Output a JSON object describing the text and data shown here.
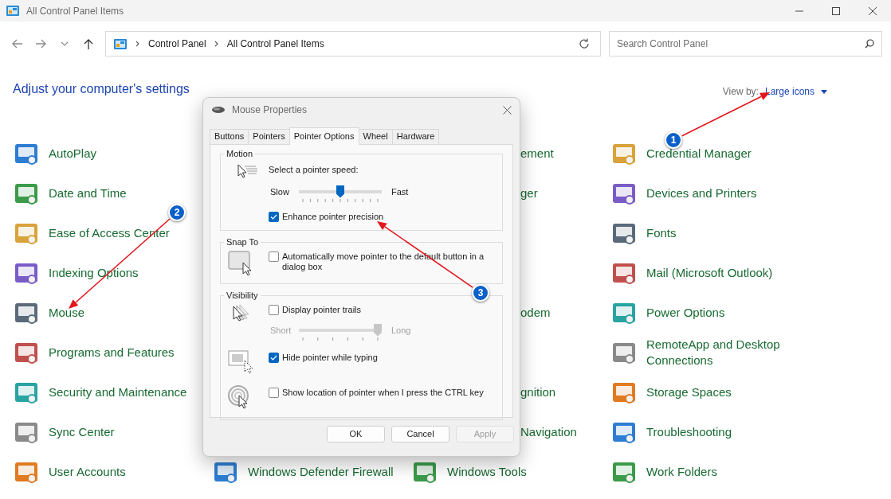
{
  "window": {
    "title": "All Control Panel Items"
  },
  "address_bar": {
    "path": [
      "Control Panel",
      "All Control Panel Items"
    ]
  },
  "search": {
    "placeholder": "Search Control Panel"
  },
  "heading": "Adjust your computer's settings",
  "view_by": {
    "label": "View by:",
    "value": "Large icons"
  },
  "columns": [
    {
      "items": [
        {
          "kind": "item",
          "label": "AutoPlay"
        },
        {
          "kind": "item",
          "label": "Date and Time"
        },
        {
          "kind": "item",
          "label": "Ease of Access Center"
        },
        {
          "kind": "item",
          "label": "Indexing Options"
        },
        {
          "kind": "item",
          "label": "Mouse"
        },
        {
          "kind": "item",
          "label": "Programs and Features"
        },
        {
          "kind": "item",
          "label": "Security and Maintenance"
        },
        {
          "kind": "item",
          "label": "Sync Center"
        },
        {
          "kind": "item",
          "label": "User Accounts"
        }
      ]
    },
    {
      "items": [
        {
          "kind": "covered"
        },
        {
          "kind": "covered"
        },
        {
          "kind": "covered"
        },
        {
          "kind": "covered"
        },
        {
          "kind": "covered"
        },
        {
          "kind": "covered"
        },
        {
          "kind": "covered"
        },
        {
          "kind": "covered"
        },
        {
          "kind": "item",
          "label": "Windows Defender Firewall"
        }
      ]
    },
    {
      "items": [
        {
          "kind": "partial",
          "label": "ement"
        },
        {
          "kind": "partial",
          "label": "ger"
        },
        {
          "kind": "covered"
        },
        {
          "kind": "covered"
        },
        {
          "kind": "partial",
          "label": "odem"
        },
        {
          "kind": "covered"
        },
        {
          "kind": "partial",
          "label": "gnition"
        },
        {
          "kind": "partial",
          "label": "Navigation"
        },
        {
          "kind": "item",
          "label": "Windows Tools"
        }
      ]
    },
    {
      "items": [
        {
          "kind": "item",
          "label": "Credential Manager"
        },
        {
          "kind": "item",
          "label": "Devices and Printers"
        },
        {
          "kind": "item",
          "label": "Fonts"
        },
        {
          "kind": "item",
          "label": "Mail (Microsoft Outlook)"
        },
        {
          "kind": "item",
          "label": "Power Options"
        },
        {
          "kind": "item",
          "label": "RemoteApp and Desktop Connections"
        },
        {
          "kind": "item",
          "label": "Storage Spaces"
        },
        {
          "kind": "item",
          "label": "Troubleshooting"
        },
        {
          "kind": "item",
          "label": "Work Folders"
        }
      ]
    }
  ],
  "dialog": {
    "title": "Mouse Properties",
    "tabs": [
      {
        "label": "Buttons",
        "selected": false
      },
      {
        "label": "Pointers",
        "selected": false
      },
      {
        "label": "Pointer Options",
        "selected": true
      },
      {
        "label": "Wheel",
        "selected": false
      },
      {
        "label": "Hardware",
        "selected": false
      }
    ],
    "groups": [
      {
        "title": "Motion",
        "sections": [
          {
            "rows": [
              {
                "kind": "text",
                "text": "Select a pointer speed:"
              },
              {
                "kind": "slider",
                "min_label": "Slow",
                "max_label": "Fast",
                "level": 0.5,
                "disabled": false
              },
              {
                "kind": "checkbox",
                "label": "Enhance pointer precision",
                "checked": true
              }
            ]
          }
        ]
      },
      {
        "title": "Snap To",
        "sections": [
          {
            "rows": [
              {
                "kind": "checkbox",
                "label": "Automatically move pointer to the default button in a dialog box",
                "checked": false
              }
            ]
          }
        ]
      },
      {
        "title": "Visibility",
        "sections": [
          {
            "rows": [
              {
                "kind": "checkbox",
                "label": "Display pointer trails",
                "checked": false
              },
              {
                "kind": "slider",
                "min_label": "Short",
                "max_label": "Long",
                "level": 1,
                "disabled": true
              }
            ]
          },
          {
            "rows": [
              {
                "kind": "checkbox",
                "label": "Hide pointer while typing",
                "checked": true
              }
            ]
          },
          {
            "rows": [
              {
                "kind": "checkbox",
                "label": "Show location of pointer when I press the CTRL key",
                "checked": false
              }
            ]
          }
        ]
      }
    ],
    "buttons": [
      {
        "label": "OK",
        "disabled": false
      },
      {
        "label": "Cancel",
        "disabled": false
      },
      {
        "label": "Apply",
        "disabled": true
      }
    ]
  },
  "annotations": [
    {
      "number": "1"
    },
    {
      "number": "2"
    },
    {
      "number": "3"
    }
  ]
}
